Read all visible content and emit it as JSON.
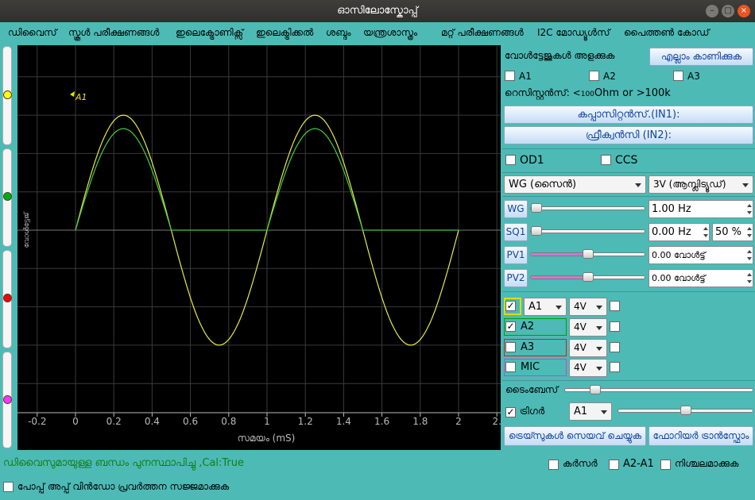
{
  "window": {
    "title": "ഓസിലോസ്കോപ്പ്",
    "min_icon": "minimize-icon",
    "max_icon": "maximize-icon",
    "close_icon": "close-icon"
  },
  "menu": [
    "ഡിവൈസ്",
    "സ്കൂൾ പരീക്ഷണങ്ങൾ",
    "ഇലെക്ട്രോണിക്സ്",
    "ഇലെക്ട്രിക്കൽ",
    "ശബ്ദം",
    "യന്ത്രശാസ്ത്രം",
    "മറ്റ് പരീക്ഷണങ്ങൾ",
    "I2C മോഡ്യൂൾസ്",
    "പൈത്തൺ കോഡ്"
  ],
  "left_markers": [
    "#ffff00",
    "#00b000",
    "#ff0000",
    "#ff33ff"
  ],
  "chart_data": {
    "type": "line",
    "xlabel": "സമയം (mS)",
    "ylabel": "വോൾട്ടേജ്",
    "x_ticks": [
      "-0.2",
      "0",
      "0.2",
      "0.4",
      "0.6",
      "0.8",
      "1",
      "1.2",
      "1.4",
      "1.6",
      "1.8",
      "2",
      "2."
    ],
    "xlim": [
      -0.2,
      2.1
    ],
    "grid": true,
    "marker_label": "A1",
    "series": [
      {
        "color": "#e8e84a",
        "x": [
          0,
          0.125,
          0.25,
          0.375,
          0.5,
          0.625,
          0.75,
          0.875,
          1.0,
          1.125,
          1.25,
          1.375,
          1.5,
          1.625,
          1.75,
          1.875,
          2.0
        ],
        "y": [
          0,
          2.12,
          3.0,
          2.12,
          0,
          -2.12,
          -3.0,
          -2.12,
          0,
          2.12,
          3.0,
          2.12,
          0,
          -2.12,
          -3.0,
          -2.12,
          0
        ]
      },
      {
        "color": "#44cc44",
        "x": [
          0,
          0.125,
          0.25,
          0.375,
          0.5,
          0.625,
          0.75,
          0.875,
          1.0,
          1.125,
          1.25,
          1.375,
          1.5,
          1.625,
          1.75,
          1.875,
          2.0
        ],
        "y": [
          0,
          1.86,
          2.65,
          1.86,
          0,
          0,
          0,
          0,
          0,
          1.86,
          2.65,
          1.86,
          0,
          0,
          0,
          0,
          0
        ]
      }
    ]
  },
  "panel": {
    "measure_label": "വോൾട്ടേജുകൾ അളക്കുക",
    "show_all": "എല്ലാം കാണിക്കുക",
    "a1": "A1",
    "a2": "A2",
    "a3": "A3",
    "resistance_prefix": "റെസിസ്റ്റൻസ്: <",
    "resistance_small": "100",
    "resistance_rest": "Ohm  or  >100k",
    "capacitance": "കപ്പാസിറ്റൻസ്.(IN1):",
    "frequency": "ഫ്രീക്വൻസി (IN2):",
    "od1": "OD1",
    "ccs": "CCS",
    "wg_type": "WG (സൈൻ)",
    "amplitude": "3V (ആമ്പ്ലിട്യൂഡ്)",
    "wg_btn": "WG",
    "wg_val": "1.00 Hz",
    "wg_slider": 0.0,
    "sq1_btn": "SQ1",
    "sq1_val": "0.00 Hz",
    "sq1_duty": "50 %",
    "sq1_slider": 0.0,
    "pv1_btn": "PV1",
    "pv1_val": "0.00 വോൾട്ട്",
    "pv1_slider": 0.5,
    "pv2_btn": "PV2",
    "pv2_val": "0.00 വോൾട്ട്",
    "pv2_slider": 0.5,
    "channels": [
      {
        "name": "A1",
        "range": "4V",
        "checked": true,
        "color": "#dddd00"
      },
      {
        "name": "A2",
        "range": "4V",
        "checked": true,
        "color": "#00a000"
      },
      {
        "name": "A3",
        "range": "4V",
        "checked": false,
        "color": "#d02020"
      },
      {
        "name": "MIC",
        "range": "4V",
        "checked": false,
        "color": "#cc44cc"
      }
    ],
    "timebase_label": "ടൈംബേസ്",
    "timebase_slider": 0.14,
    "trigger_label": "ട്രിഗർ",
    "trigger_source": "A1",
    "trigger_slider": 0.5,
    "save_traces": "ട്രെയ്സുകൾ സെയവ് ചെയ്യുക",
    "fourier": "ഫോറിയർ ട്രാൻസ്ഫോം"
  },
  "status": {
    "message": "ഡിവൈസുമായുള്ള ബന്ധം പുനസ്ഥാപിച്ചു ,Cal:True",
    "cursor": "കർസർ",
    "a2a1": "A2-A1",
    "freeze": "നിശ്ചലമാക്കുക",
    "popup": "പോപ്പ് അപ്പ് വിൻഡോ പ്രവർത്തന സജ്ജമാക്കുക"
  }
}
